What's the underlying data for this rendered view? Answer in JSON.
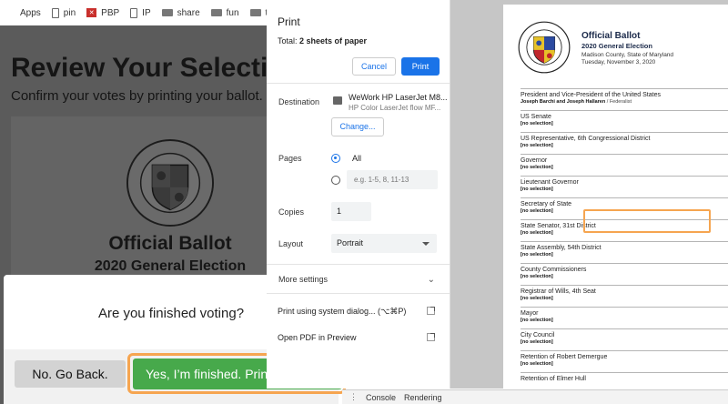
{
  "bookmarks": [
    {
      "label": "Apps",
      "icon": "apps-grid-icon"
    },
    {
      "label": "pin",
      "icon": "page-icon"
    },
    {
      "label": "PBP",
      "icon": "pbp-icon"
    },
    {
      "label": "IP",
      "icon": "page-icon"
    },
    {
      "label": "share",
      "icon": "folder-icon"
    },
    {
      "label": "fun",
      "icon": "folder-icon"
    },
    {
      "label": "tools",
      "icon": "folder-icon"
    }
  ],
  "page": {
    "title": "Review Your Selecti",
    "subtitle": "Confirm your votes by printing your ballot.",
    "ballot_title": "Official Ballot",
    "ballot_subtitle": "2020 General Election"
  },
  "modal": {
    "question": "Are you finished voting?",
    "back_label": "No. Go Back.",
    "confirm_label": "Yes, I’m finished. Print"
  },
  "print": {
    "title": "Print",
    "total_prefix": "Total: ",
    "total_value": "2 sheets of paper",
    "cancel_label": "Cancel",
    "print_label": "Print",
    "destination_label": "Destination",
    "destination_name": "WeWork HP LaserJet M8...",
    "destination_model": "HP Color LaserJet flow MF...",
    "change_label": "Change...",
    "pages_label": "Pages",
    "pages_all": "All",
    "pages_placeholder": "e.g. 1-5, 8, 11-13",
    "copies_label": "Copies",
    "copies_value": "1",
    "layout_label": "Layout",
    "layout_value": "Portrait",
    "more_settings": "More settings",
    "system_dialog": "Print using system dialog... (⌥⌘P)",
    "open_pdf": "Open PDF in Preview"
  },
  "sheet": {
    "title": "Official Ballot",
    "subtitle": "2020 General Election",
    "location": "Madison County, State of Maryland",
    "date": "Tuesday, November 3, 2020",
    "seal_text": "THE SEAL OF MONTGOMERY COUNTY, MARYLAND",
    "seal_year": "1775",
    "contests": [
      {
        "title": "President and Vice-President of the United States",
        "selection": "Joseph Barchi and Joseph Hallaren",
        "party": " / Federalist"
      },
      {
        "title": "US Senate",
        "selection": "[no selection]",
        "party": ""
      },
      {
        "title": "US Representative, 6th Congressional District",
        "selection": "[no selection]",
        "party": ""
      },
      {
        "title": "Governor",
        "selection": "[no selection]",
        "party": ""
      },
      {
        "title": "Lieutenant Governor",
        "selection": "[no selection]",
        "party": ""
      },
      {
        "title": "Secretary of State",
        "selection": "[no selection]",
        "party": ""
      },
      {
        "title": "State Senator, 31st District",
        "selection": "[no selection]",
        "party": ""
      },
      {
        "title": "State Assembly, 54th District",
        "selection": "[no selection]",
        "party": ""
      },
      {
        "title": "County Commissioners",
        "selection": "[no selection]",
        "party": ""
      },
      {
        "title": "Registrar of Wills, 4th Seat",
        "selection": "[no selection]",
        "party": ""
      },
      {
        "title": "Mayor",
        "selection": "[no selection]",
        "party": ""
      },
      {
        "title": "City Council",
        "selection": "[no selection]",
        "party": ""
      },
      {
        "title": "Retention of Robert Demergue",
        "selection": "[no selection]",
        "party": ""
      },
      {
        "title": "Retention of Elmer Hull",
        "selection": "",
        "party": ""
      }
    ]
  },
  "devtools": {
    "tab1": "Console",
    "tab2": "Rendering"
  },
  "colors": {
    "accent_blue": "#1a73e8",
    "confirm_green": "#47a94b",
    "highlight_orange": "#f6a550",
    "overlay_gray": "#5b5b5b"
  }
}
